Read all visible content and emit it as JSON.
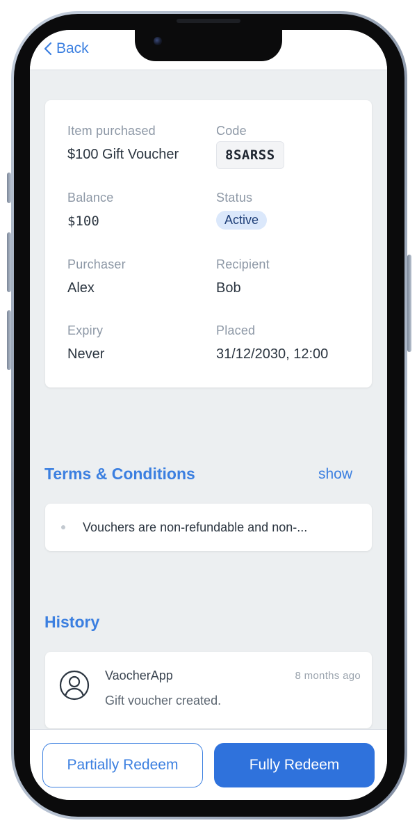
{
  "nav": {
    "back_label": "Back"
  },
  "details": {
    "item_purchased": {
      "label": "Item purchased",
      "value": "$100 Gift Voucher"
    },
    "code": {
      "label": "Code",
      "value": "8SARSS"
    },
    "balance": {
      "label": "Balance",
      "value": "$100"
    },
    "status": {
      "label": "Status",
      "value": "Active"
    },
    "purchaser": {
      "label": "Purchaser",
      "value": "Alex"
    },
    "recipient": {
      "label": "Recipient",
      "value": "Bob"
    },
    "expiry": {
      "label": "Expiry",
      "value": "Never"
    },
    "placed": {
      "label": "Placed",
      "value": "31/12/2030, 12:00"
    }
  },
  "terms": {
    "title": "Terms & Conditions",
    "toggle_label": "show",
    "items": [
      "Vouchers are non-refundable and non-..."
    ]
  },
  "history": {
    "title": "History",
    "entries": [
      {
        "actor": "VaocherApp",
        "time": "8 months ago",
        "message": "Gift voucher created.",
        "icon": "user-circle-icon"
      }
    ]
  },
  "actions": {
    "partial_label": "Partially Redeem",
    "full_label": "Fully Redeem"
  },
  "colors": {
    "accent": "#3b7fe0",
    "primary_button": "#2f72dc",
    "badge_bg": "#dbe8fb",
    "screen_bg": "#eceff1"
  }
}
